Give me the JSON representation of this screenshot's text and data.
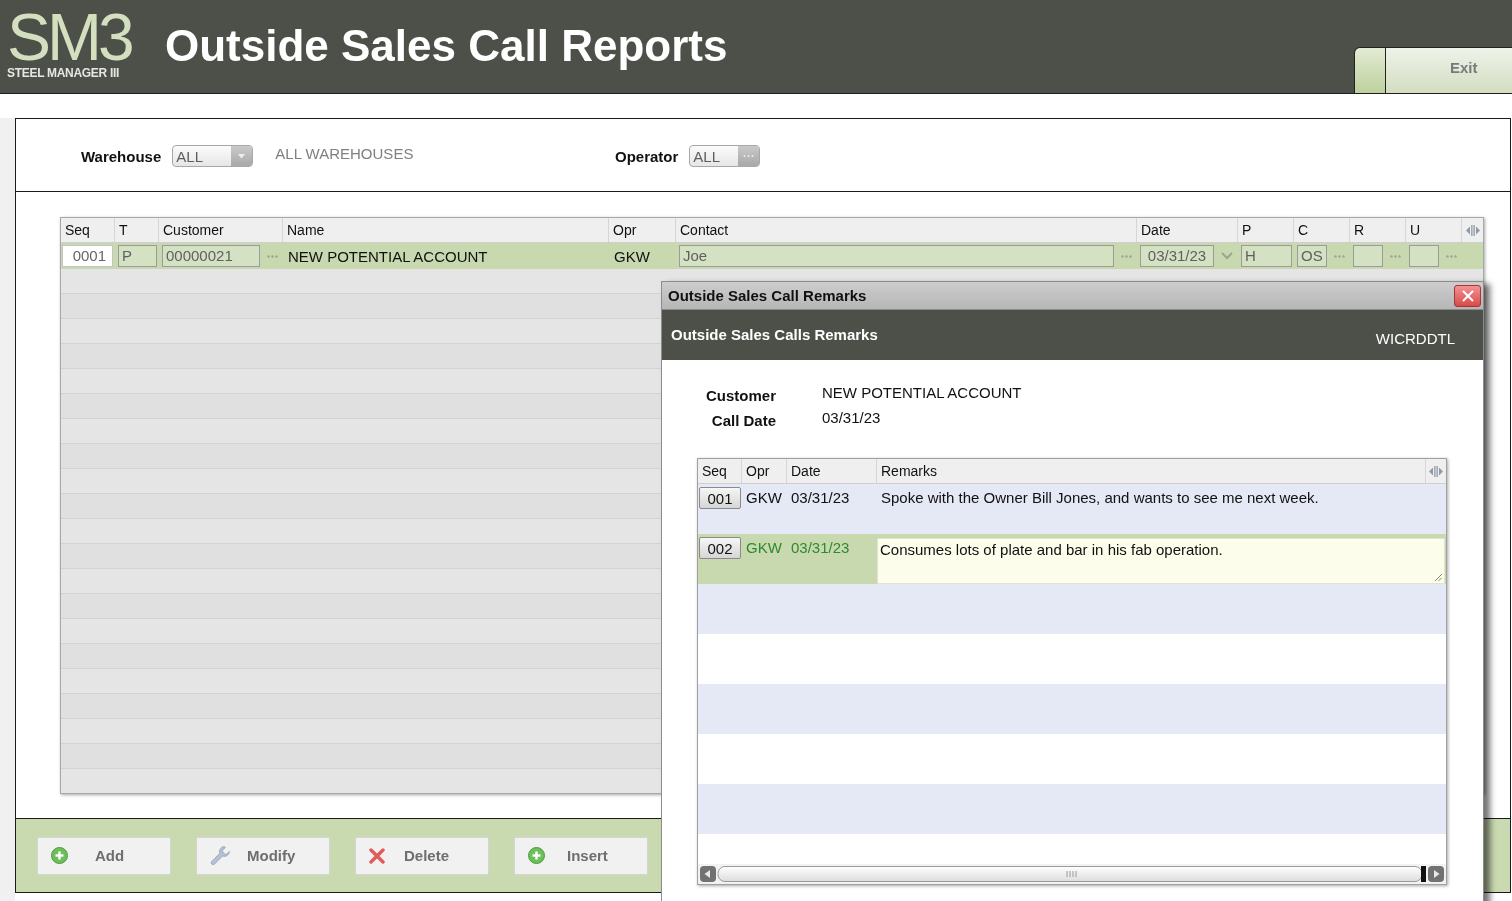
{
  "header": {
    "logo_mark": "SM3",
    "logo_subtitle": "STEEL MANAGER III",
    "title": "Outside Sales Call Reports",
    "exit_label": "Exit"
  },
  "filters": [
    {
      "kind": "dropdown",
      "label": "Warehouse",
      "value": "ALL",
      "description": "ALL WAREHOUSES"
    },
    {
      "kind": "lookup",
      "label": "Operator",
      "value": "ALL"
    }
  ],
  "calls_table": {
    "columns": [
      {
        "label": "Seq"
      },
      {
        "label": "T"
      },
      {
        "label": "Customer"
      },
      {
        "label": "Name"
      },
      {
        "label": "Opr"
      },
      {
        "label": "Contact"
      },
      {
        "label": "Date"
      },
      {
        "label": "P"
      },
      {
        "label": "C"
      },
      {
        "label": "R"
      },
      {
        "label": "U"
      }
    ],
    "rows": [
      {
        "selected": true,
        "cells": [
          {
            "kind": "seq",
            "value": "0001"
          },
          {
            "kind": "field",
            "value": "P"
          },
          {
            "kind": "lookup",
            "value": "00000021"
          },
          {
            "kind": "text",
            "value": "NEW POTENTIAL ACCOUNT"
          },
          {
            "kind": "text",
            "value": "GKW"
          },
          {
            "kind": "lookup",
            "value": "Joe"
          },
          {
            "kind": "date",
            "value": "03/31/23"
          },
          {
            "kind": "field",
            "value": "H"
          },
          {
            "kind": "lookup",
            "value": "OS"
          },
          {
            "kind": "lookup"
          },
          {
            "kind": "lookup"
          }
        ]
      }
    ]
  },
  "actions": [
    {
      "kind": "add",
      "label": "Add"
    },
    {
      "kind": "modify",
      "label": "Modify"
    },
    {
      "kind": "delete",
      "label": "Delete"
    },
    {
      "kind": "insert",
      "label": "Insert"
    }
  ],
  "remarks_dialog": {
    "title": "Outside Sales Call Remarks",
    "heading": "Outside Sales Calls Remarks",
    "code": "WICRDDTL",
    "fields": [
      {
        "label": "Customer",
        "value": "NEW POTENTIAL ACCOUNT"
      },
      {
        "label": "Call Date",
        "value": "03/31/23"
      }
    ],
    "remarks_table": {
      "columns": [
        {
          "label": "Seq"
        },
        {
          "label": "Opr"
        },
        {
          "label": "Date"
        },
        {
          "label": "Remarks"
        }
      ],
      "rows": [
        {
          "selected": false,
          "seq": "001",
          "opr": "GKW",
          "date": "03/31/23",
          "remarks": "Spoke with the Owner Bill Jones, and wants to see me next week."
        },
        {
          "selected": true,
          "seq": "002",
          "opr": "GKW",
          "date": "03/31/23",
          "remarks": "Consumes lots of plate and bar in his fab operation."
        }
      ]
    }
  }
}
